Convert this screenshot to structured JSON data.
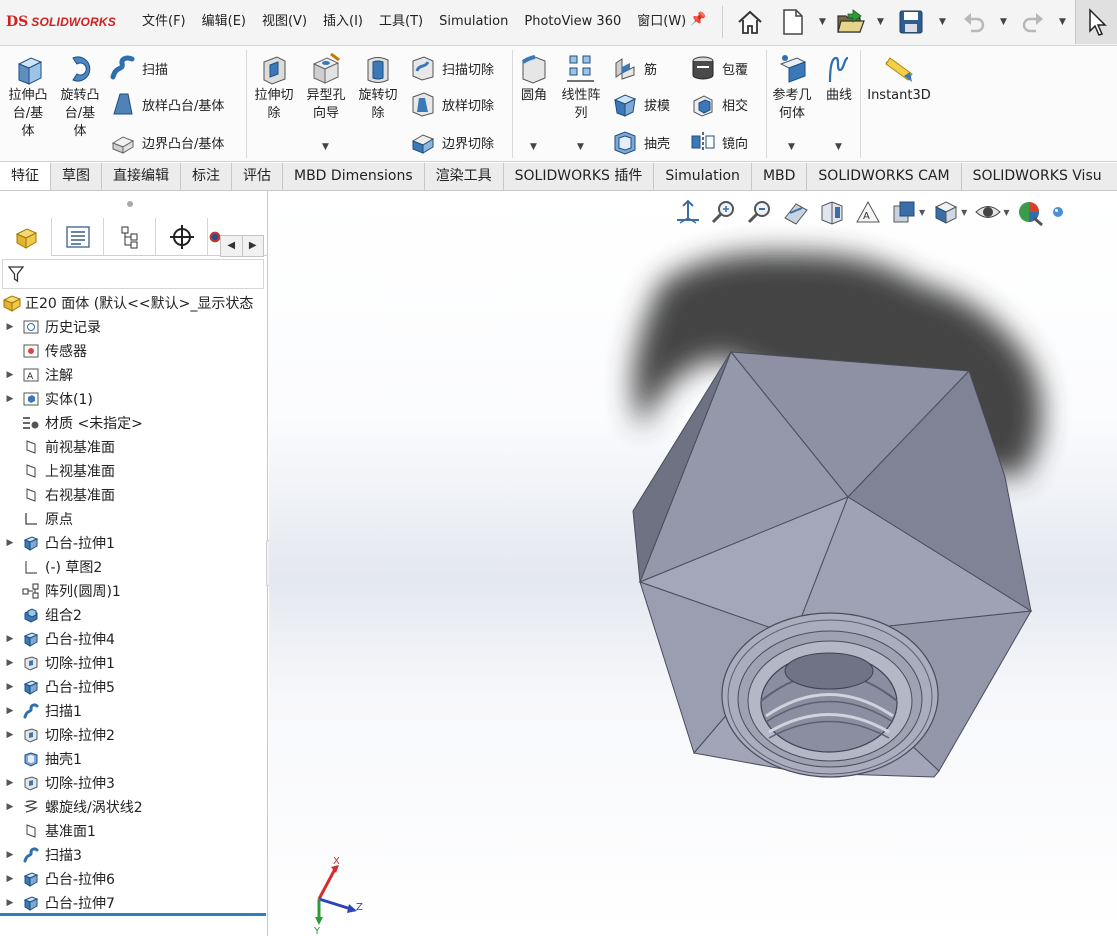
{
  "app": {
    "logo_text": "SOLIDWORKS",
    "logo_mark": "DS"
  },
  "menubar": {
    "menus": [
      "文件(F)",
      "编辑(E)",
      "视图(V)",
      "插入(I)",
      "工具(T)",
      "Simulation",
      "PhotoView 360",
      "窗口(W)"
    ],
    "toolbar_icons": [
      "home-icon",
      "new-document-icon",
      "open-icon",
      "save-icon",
      "undo-icon",
      "redo-icon",
      "select-cursor-icon"
    ]
  },
  "ribbon": {
    "extrude_boss": "拉伸凸\n台/基\n体",
    "revolve_boss": "旋转凸\n台/基\n体",
    "sweep": "扫描",
    "loft_boss": "放样凸台/基体",
    "boundary_boss": "边界凸台/基体",
    "extrude_cut": "拉伸切\n除",
    "hole_wizard": "异型孔\n向导",
    "revolve_cut": "旋转切\n除",
    "sweep_cut": "扫描切除",
    "loft_cut": "放样切除",
    "boundary_cut": "边界切除",
    "fillet": "圆角",
    "linear_pattern": "线性阵\n列",
    "rib": "筋",
    "draft": "拔模",
    "shell": "抽壳",
    "wrap": "包覆",
    "intersect": "相交",
    "mirror": "镜向",
    "reference_geometry": "参考几\n何体",
    "curves": "曲线",
    "instant3d": "Instant3D"
  },
  "tabs": [
    "特征",
    "草图",
    "直接编辑",
    "标注",
    "评估",
    "MBD Dimensions",
    "渲染工具",
    "SOLIDWORKS 插件",
    "Simulation",
    "MBD",
    "SOLIDWORKS CAM",
    "SOLIDWORKS Visu"
  ],
  "active_tab": "特征",
  "feature_tree": {
    "root": "正20 面体  (默认<<默认>_显示状态",
    "items": [
      {
        "label": "历史记录",
        "icon": "history-icon",
        "expandable": true
      },
      {
        "label": "传感器",
        "icon": "sensor-icon",
        "expandable": false
      },
      {
        "label": "注解",
        "icon": "annotation-icon",
        "expandable": true
      },
      {
        "label": "实体(1)",
        "icon": "solid-bodies-icon",
        "expandable": true
      },
      {
        "label": "材质 <未指定>",
        "icon": "material-icon",
        "expandable": false
      },
      {
        "label": "前视基准面",
        "icon": "plane-icon",
        "expandable": false
      },
      {
        "label": "上视基准面",
        "icon": "plane-icon",
        "expandable": false
      },
      {
        "label": "右视基准面",
        "icon": "plane-icon",
        "expandable": false
      },
      {
        "label": "原点",
        "icon": "origin-icon",
        "expandable": false
      },
      {
        "label": "凸台-拉伸1",
        "icon": "extrude-icon",
        "expandable": true
      },
      {
        "label": "(-) 草图2",
        "icon": "sketch-icon",
        "expandable": false
      },
      {
        "label": "阵列(圆周)1",
        "icon": "circular-pattern-icon",
        "expandable": false
      },
      {
        "label": "组合2",
        "icon": "combine-icon",
        "expandable": false
      },
      {
        "label": "凸台-拉伸4",
        "icon": "extrude-icon",
        "expandable": true
      },
      {
        "label": "切除-拉伸1",
        "icon": "cut-extrude-icon",
        "expandable": true
      },
      {
        "label": "凸台-拉伸5",
        "icon": "extrude-icon",
        "expandable": true
      },
      {
        "label": "扫描1",
        "icon": "sweep-icon",
        "expandable": true
      },
      {
        "label": "切除-拉伸2",
        "icon": "cut-extrude-icon",
        "expandable": true
      },
      {
        "label": "抽壳1",
        "icon": "shell-icon",
        "expandable": false
      },
      {
        "label": "切除-拉伸3",
        "icon": "cut-extrude-icon",
        "expandable": true
      },
      {
        "label": "螺旋线/涡状线2",
        "icon": "helix-icon",
        "expandable": true
      },
      {
        "label": "基准面1",
        "icon": "plane-icon",
        "expandable": false
      },
      {
        "label": "扫描3",
        "icon": "sweep-icon",
        "expandable": true
      },
      {
        "label": "凸台-拉伸6",
        "icon": "extrude-icon",
        "expandable": true
      },
      {
        "label": "凸台-拉伸7",
        "icon": "extrude-icon",
        "expandable": true
      }
    ]
  },
  "panel_tabs": [
    "feature-manager-icon",
    "property-manager-icon",
    "configuration-manager-icon",
    "dimxpert-icon",
    "display-manager-icon"
  ],
  "viewport": {
    "triad": {
      "x": "X",
      "y": "Y",
      "z": "Z"
    },
    "model_color": "#8e93a6",
    "heads_up_icons": [
      "zoom-to-fit-icon",
      "zoom-to-area-icon",
      "previous-view-icon",
      "section-view-icon",
      "dynamic-annotation-icon",
      "view-orientation-icon",
      "display-style-icon",
      "hide-show-icon",
      "edit-appearance-icon",
      "apply-scene-icon"
    ]
  }
}
